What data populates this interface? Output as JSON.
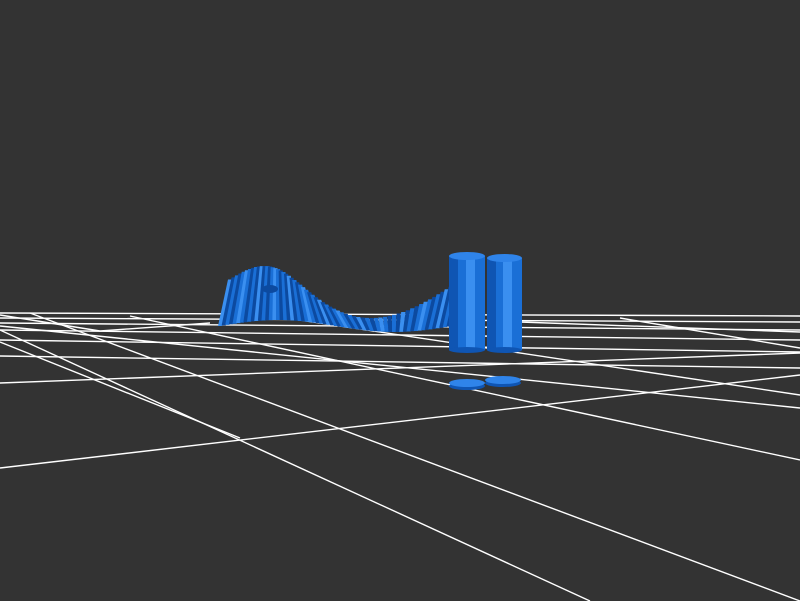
{
  "viewer": {
    "background_color": "#333333",
    "grid_color": "#ffffff",
    "model_color": "#1a6fd6",
    "model_highlight": "#3a8ff0",
    "model_shadow": "#0c4aa0"
  },
  "scene_objects": [
    {
      "name": "twisted-ribbon-strip"
    },
    {
      "name": "upright-cylinder-left"
    },
    {
      "name": "upright-cylinder-right"
    },
    {
      "name": "flat-disc-left"
    },
    {
      "name": "flat-disc-right"
    }
  ]
}
